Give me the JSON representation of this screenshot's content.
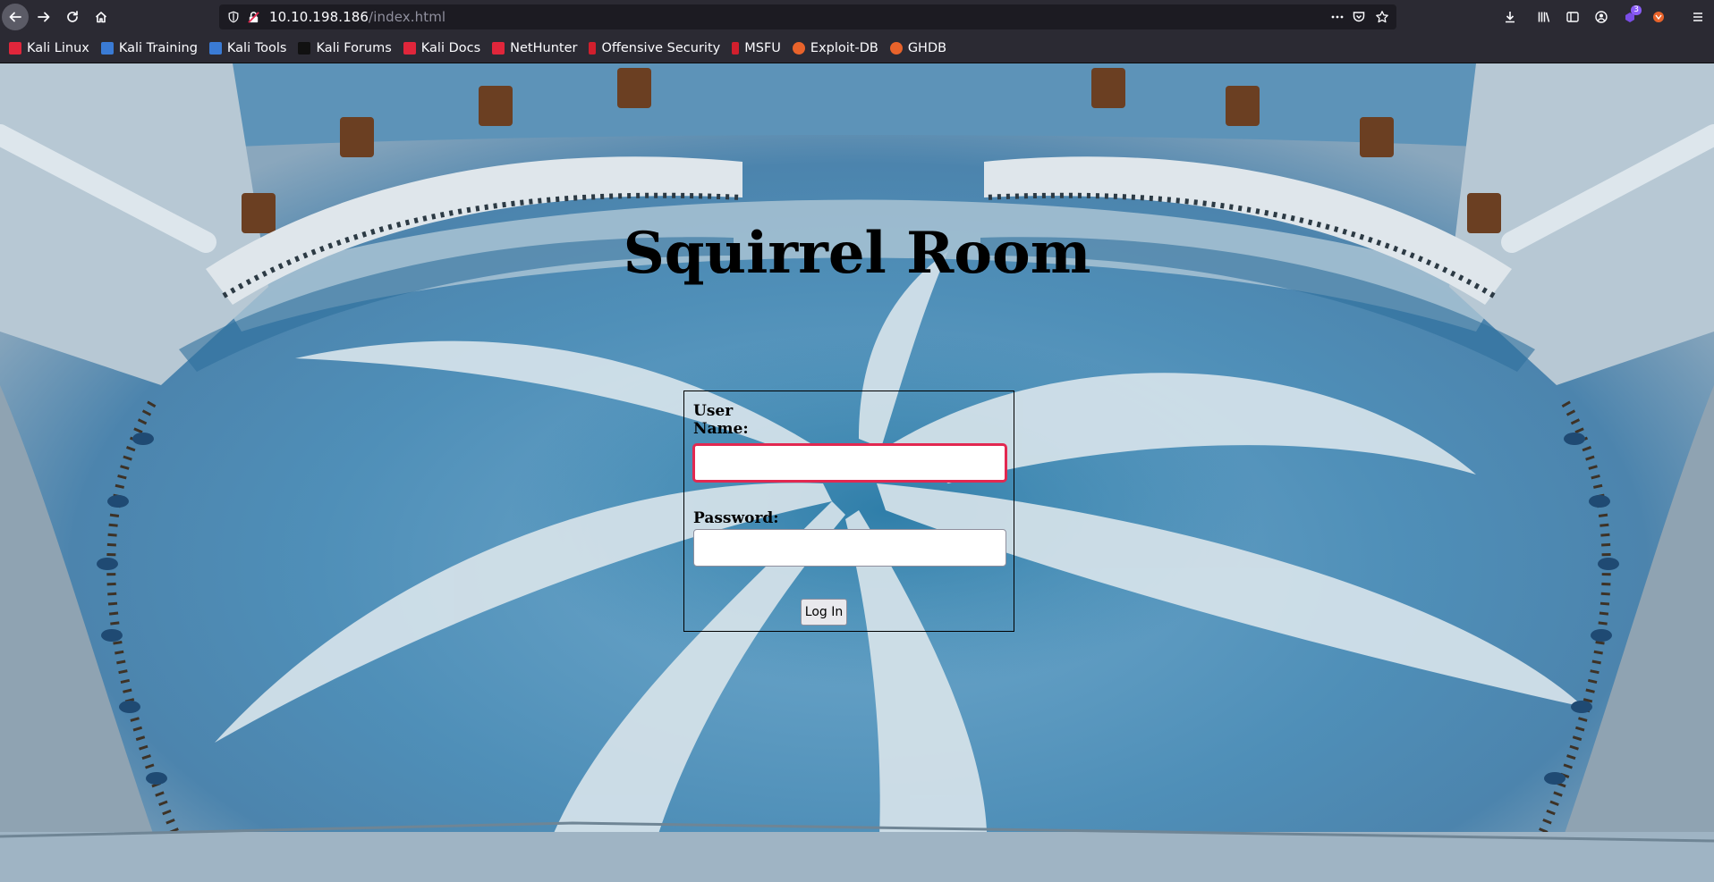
{
  "browser": {
    "url_host": "10.10.198.186",
    "url_path": "/index.html",
    "notification_badge": "3"
  },
  "bookmarks": [
    {
      "label": "Kali Linux",
      "color": "#e0263b"
    },
    {
      "label": "Kali Training",
      "color": "#3a7bd5"
    },
    {
      "label": "Kali Tools",
      "color": "#3a7bd5"
    },
    {
      "label": "Kali Forums",
      "color": "#111111"
    },
    {
      "label": "Kali Docs",
      "color": "#e0263b"
    },
    {
      "label": "NetHunter",
      "color": "#e0263b"
    },
    {
      "label": "Offensive Security",
      "color": "#d11f2d"
    },
    {
      "label": "MSFU",
      "color": "#d11f2d"
    },
    {
      "label": "Exploit-DB",
      "color": "#e8632b"
    },
    {
      "label": "GHDB",
      "color": "#e8632b"
    }
  ],
  "page": {
    "title": "Squirrel Room",
    "login": {
      "username_label": "User Name:",
      "username_value": "",
      "password_label": "Password:",
      "password_value": "",
      "submit_label": "Log In"
    }
  }
}
